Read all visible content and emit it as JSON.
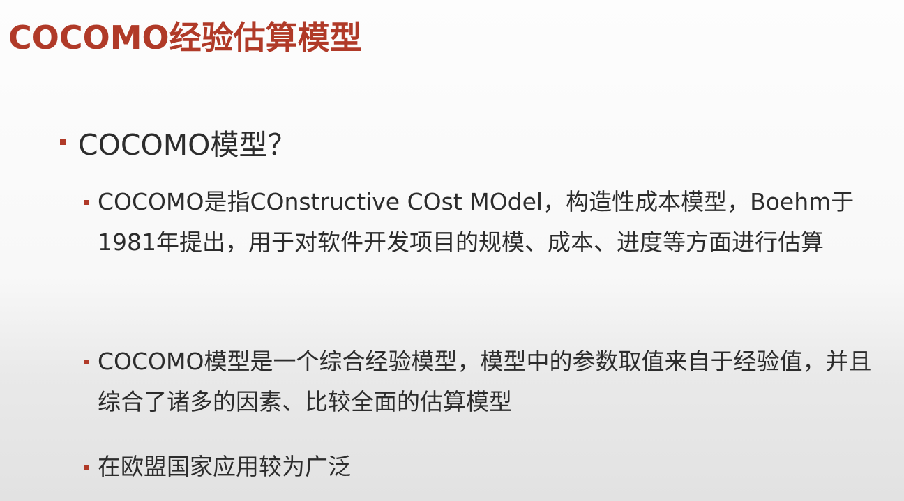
{
  "slide": {
    "title": "COCOMO经验估算模型",
    "heading_bullet": "COCOMO模型？",
    "bullets": [
      {
        "text": "COCOMO是指COnstructive COst MOdel，构造性成本模型，Boehm于1981年提出，用于对软件开发项目的规模、成本、进度等方面进行估算"
      },
      {
        "text": "COCOMO模型是一个综合经验模型，模型中的参数取值来自于经验值，并且综合了诸多的因素、比较全面的估算模型"
      },
      {
        "text": "在欧盟国家应用较为广泛"
      }
    ]
  },
  "colors": {
    "accent": "#b03a28",
    "text": "#2c2c2c"
  }
}
